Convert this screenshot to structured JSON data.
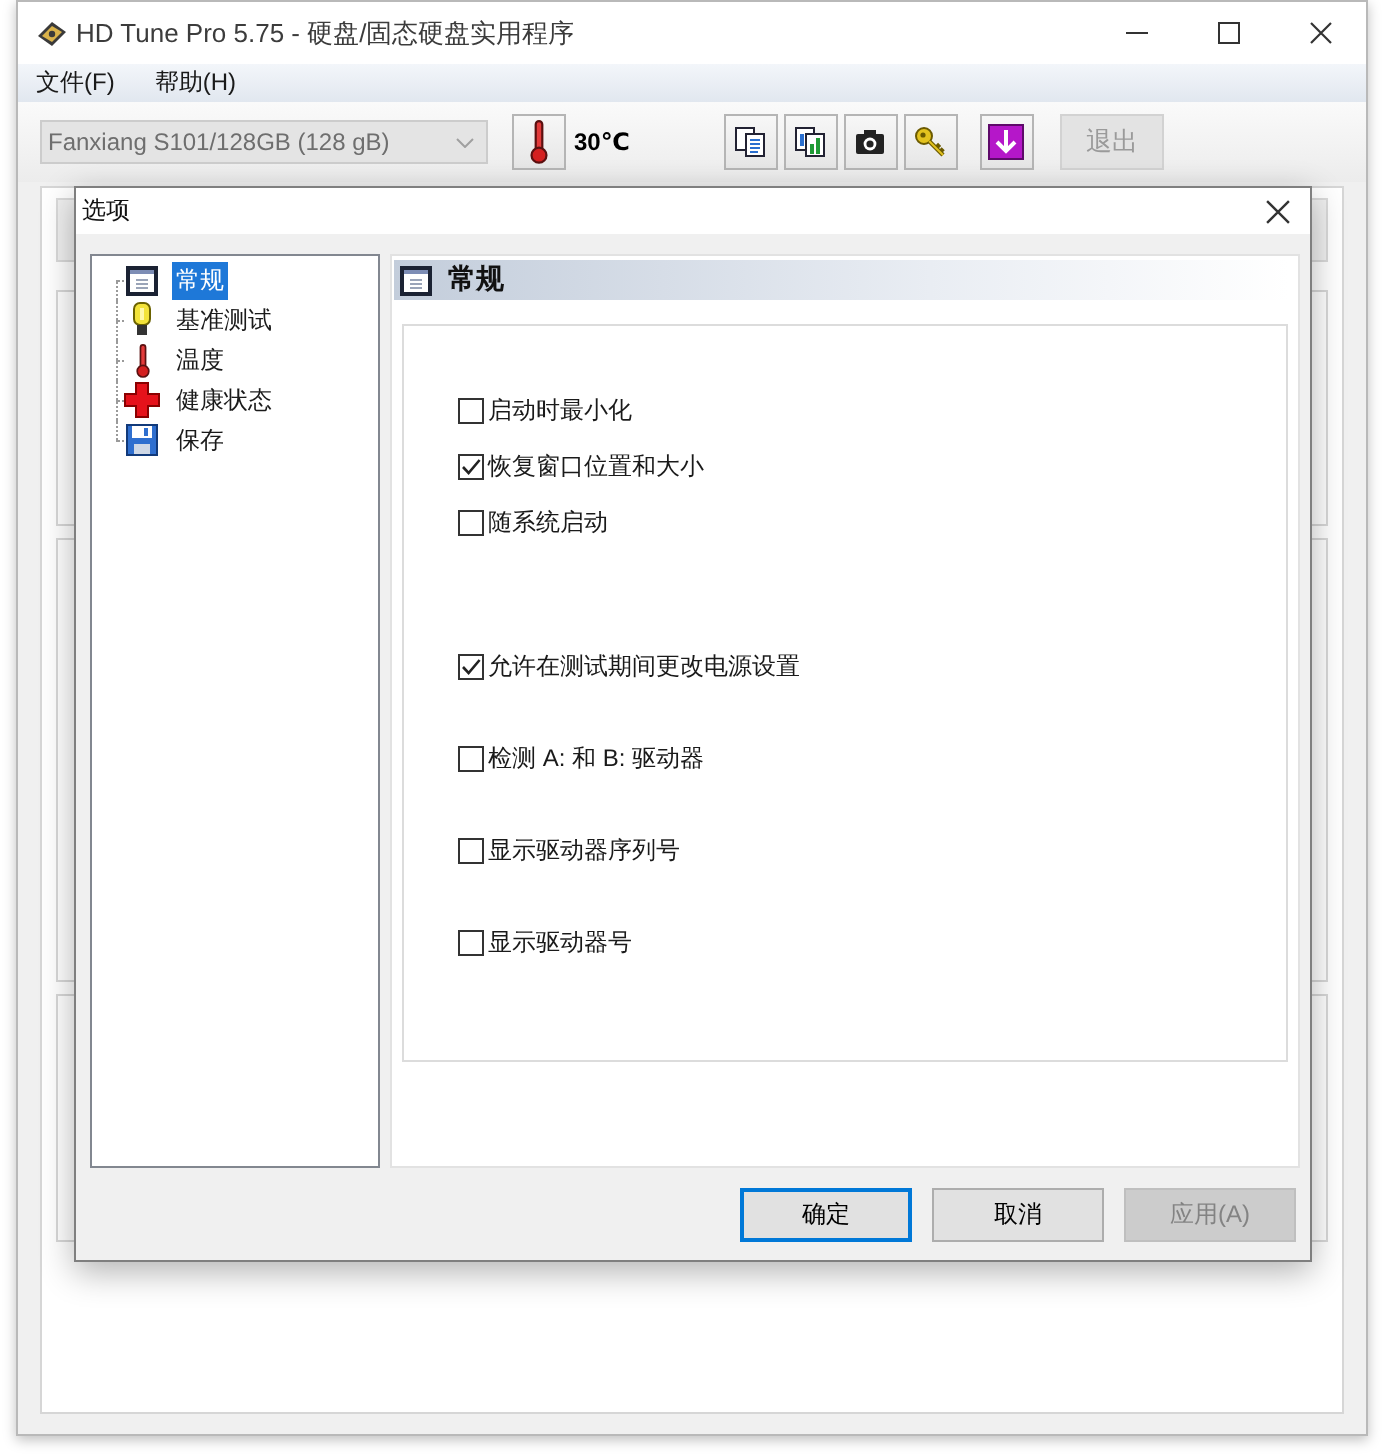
{
  "window": {
    "title": "HD Tune Pro 5.75 - 硬盘/固态硬盘实用程序"
  },
  "menu": [
    {
      "label": "文件(F)"
    },
    {
      "label": "帮助(H)"
    }
  ],
  "toolbar": {
    "drive": {
      "value": "Fanxiang S101/128GB (128 gB)",
      "disabled": true
    },
    "temperature": "30℃",
    "exit": {
      "label": "退出",
      "disabled": true
    }
  },
  "dialog": {
    "title": "选项",
    "tree": [
      {
        "label": "常规",
        "selected": true
      },
      {
        "label": "基准测试",
        "selected": false
      },
      {
        "label": "温度",
        "selected": false
      },
      {
        "label": "健康状态",
        "selected": false
      },
      {
        "label": "保存",
        "selected": false
      }
    ],
    "section_title": "常规",
    "option_groups": [
      {
        "options": [
          {
            "label": "启动时最小化",
            "checked": false
          },
          {
            "label": "恢复窗口位置和大小",
            "checked": true
          },
          {
            "label": "随系统启动",
            "checked": false
          }
        ]
      },
      {
        "options": [
          {
            "label": "允许在测试期间更改电源设置",
            "checked": true
          },
          {
            "label": "检测 A: 和 B: 驱动器",
            "checked": false
          },
          {
            "label": "显示驱动器序列号",
            "checked": false
          },
          {
            "label": "显示驱动器号",
            "checked": false
          }
        ]
      }
    ],
    "buttons": [
      {
        "label": "确定",
        "default": true,
        "disabled": false
      },
      {
        "label": "取消",
        "default": false,
        "disabled": false
      },
      {
        "label": "应用(A)",
        "default": false,
        "disabled": true
      }
    ]
  }
}
